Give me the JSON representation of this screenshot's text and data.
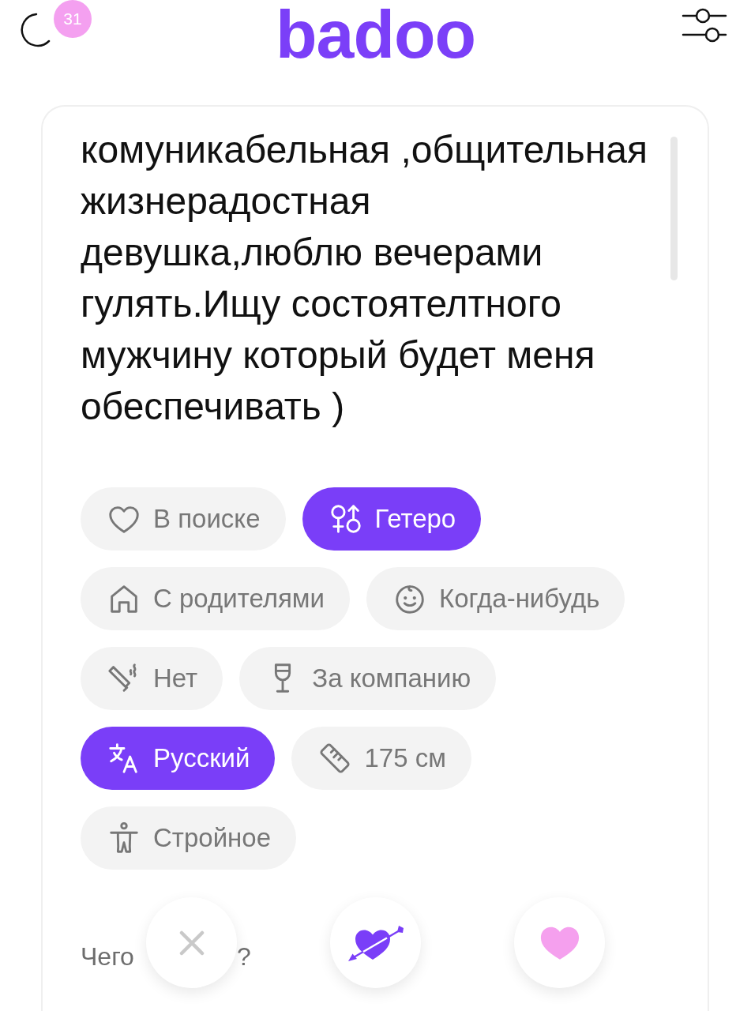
{
  "header": {
    "badge": "31",
    "logo": "badoo"
  },
  "profile": {
    "bio": "комуникабельная ,общительная жизнерадостная девушка,люблю вечерами гулять.Ищу состоятелтного мужчину который будет меня обеспечивать )",
    "chips": [
      {
        "kind": "relationship",
        "label": "В поиске",
        "highlighted": false
      },
      {
        "kind": "orientation",
        "label": "Гетеро",
        "highlighted": true
      },
      {
        "kind": "living",
        "label": "С родителями",
        "highlighted": false
      },
      {
        "kind": "children",
        "label": "Когда-нибудь",
        "highlighted": false
      },
      {
        "kind": "smoking",
        "label": "Нет",
        "highlighted": false
      },
      {
        "kind": "drinking",
        "label": "За компанию",
        "highlighted": false
      },
      {
        "kind": "language",
        "label": "Русский",
        "highlighted": true
      },
      {
        "kind": "height",
        "label": "175 см",
        "highlighted": false
      },
      {
        "kind": "body",
        "label": "Стройное",
        "highlighted": false
      }
    ],
    "next_heading": {
      "start": "Чего",
      "end": "?"
    }
  },
  "actions": [
    {
      "kind": "pass"
    },
    {
      "kind": "crush"
    },
    {
      "kind": "like"
    }
  ]
}
